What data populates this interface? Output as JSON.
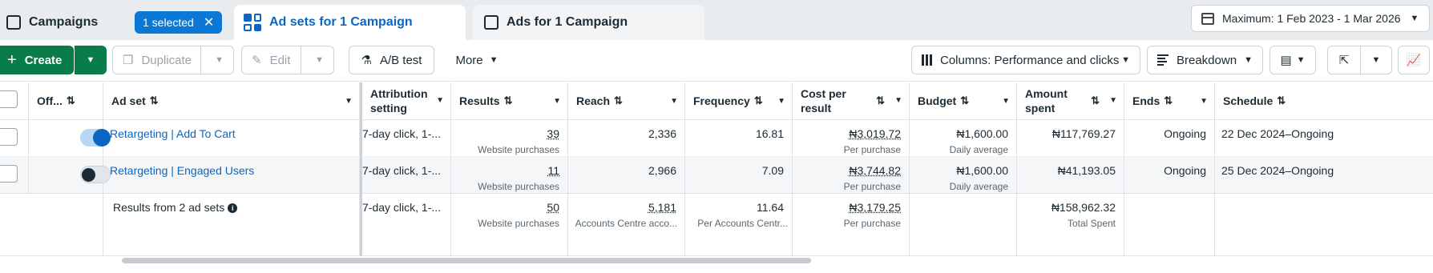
{
  "tabs": {
    "campaigns": "Campaigns",
    "selected_chip": "1 selected",
    "adsets": "Ad sets for 1 Campaign",
    "ads": "Ads for 1 Campaign"
  },
  "date_range": "Maximum: 1 Feb 2023 - 1 Mar 2026",
  "toolbar": {
    "create": "Create",
    "duplicate": "Duplicate",
    "edit": "Edit",
    "ab_test": "A/B test",
    "more": "More",
    "columns": "Columns: Performance and clicks",
    "breakdown": "Breakdown"
  },
  "headers": {
    "off_on": "Off...",
    "ad_set": "Ad set",
    "attribution_1": "Attribution",
    "attribution_2": "setting",
    "results": "Results",
    "reach": "Reach",
    "frequency": "Frequency",
    "cost_1": "Cost per",
    "cost_2": "result",
    "budget": "Budget",
    "amount_1": "Amount",
    "amount_2": "spent",
    "ends": "Ends",
    "schedule": "Schedule"
  },
  "rows": [
    {
      "name": "Retargeting | Add To Cart",
      "enabled": true,
      "attribution": "7-day click, 1-...",
      "results": "39",
      "results_sub": "Website purchases",
      "reach": "2,336",
      "frequency": "16.81",
      "cost": "₦3,019.72",
      "cost_sub": "Per purchase",
      "budget": "₦1,600.00",
      "budget_sub": "Daily average",
      "spent": "₦117,769.27",
      "ends": "Ongoing",
      "schedule": "22 Dec 2024–Ongoing"
    },
    {
      "name": "Retargeting | Engaged Users",
      "enabled": false,
      "attribution": "7-day click, 1-...",
      "results": "11",
      "results_sub": "Website purchases",
      "reach": "2,966",
      "frequency": "7.09",
      "cost": "₦3,744.82",
      "cost_sub": "Per purchase",
      "budget": "₦1,600.00",
      "budget_sub": "Daily average",
      "spent": "₦41,193.05",
      "ends": "Ongoing",
      "schedule": "25 Dec 2024–Ongoing"
    }
  ],
  "totals": {
    "label": "Results from 2 ad sets",
    "attribution": "7-day click, 1-...",
    "results": "50",
    "results_sub": "Website purchases",
    "reach": "5,181",
    "reach_sub": "Accounts Centre acco...",
    "frequency": "11.64",
    "frequency_sub": "Per Accounts Centr...",
    "cost": "₦3,179.25",
    "cost_sub": "Per purchase",
    "spent": "₦158,962.32",
    "spent_sub": "Total Spent"
  },
  "colors": {
    "accent": "#0a66c2",
    "create": "#0a7c4a",
    "chip": "#0a78d4"
  }
}
